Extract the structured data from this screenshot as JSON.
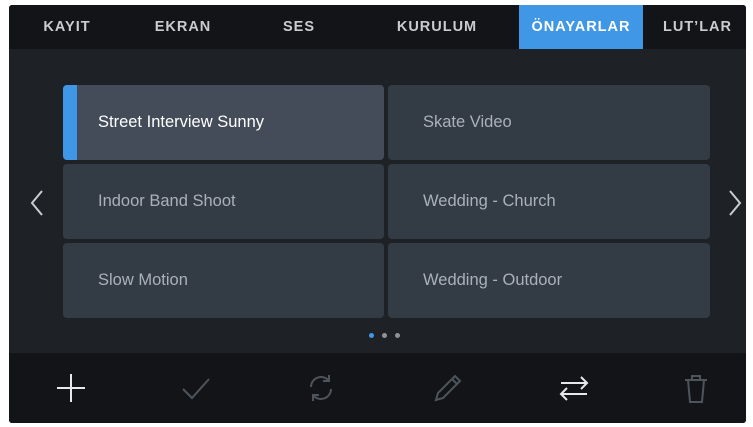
{
  "tabs": [
    {
      "label": "KAYIT",
      "active": false
    },
    {
      "label": "EKRAN",
      "active": false
    },
    {
      "label": "SES",
      "active": false
    },
    {
      "label": "KURULUM",
      "active": false
    },
    {
      "label": "ÖNAYARLAR",
      "active": true
    },
    {
      "label": "LUT’LAR",
      "active": false
    }
  ],
  "presets": [
    {
      "label": "Street Interview Sunny",
      "selected": true
    },
    {
      "label": "Skate Video",
      "selected": false
    },
    {
      "label": "Indoor Band Shoot",
      "selected": false
    },
    {
      "label": "Wedding  - Church",
      "selected": false
    },
    {
      "label": "Slow Motion",
      "selected": false
    },
    {
      "label": "Wedding - Outdoor",
      "selected": false
    }
  ],
  "pagination": {
    "pages": 3,
    "current": 1
  },
  "toolbar": {
    "tools": [
      {
        "icon": "plus-icon",
        "enabled": true
      },
      {
        "icon": "check-icon",
        "enabled": false
      },
      {
        "icon": "refresh-icon",
        "enabled": false
      },
      {
        "icon": "pencil-icon",
        "enabled": false
      },
      {
        "icon": "swap-arrows-icon",
        "enabled": true
      },
      {
        "icon": "trash-icon",
        "enabled": false
      }
    ]
  },
  "colors": {
    "accent": "#3f97e6",
    "background": "#1e2227",
    "bar": "#121417",
    "cell": "#333b45",
    "cell_selected": "#434c58"
  }
}
